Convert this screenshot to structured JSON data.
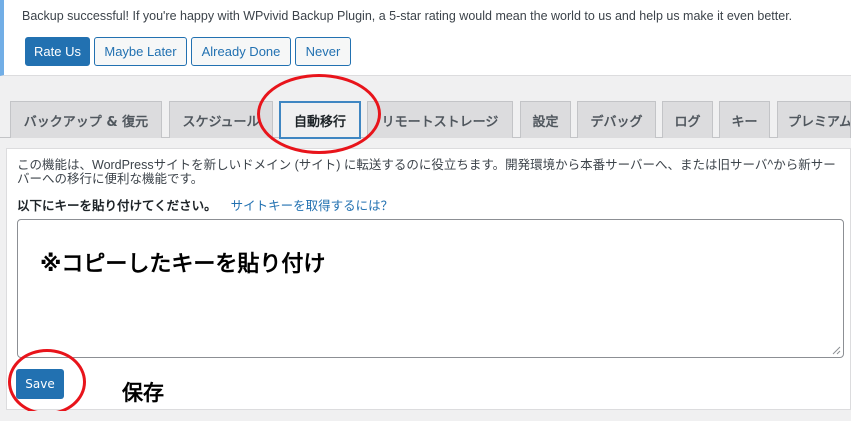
{
  "notice": {
    "text": "Backup successful! If you're happy with WPvivid Backup Plugin, a 5-star rating would mean the world to us and help us make it even better.",
    "buttons": [
      "Rate Us",
      "Maybe Later",
      "Already Done",
      "Never"
    ]
  },
  "tabs": [
    {
      "label": "バックアップ & 復元"
    },
    {
      "label": "スケジュール"
    },
    {
      "label": "自動移行",
      "active": true
    },
    {
      "label": "リモートストレージ"
    },
    {
      "label": "設定"
    },
    {
      "label": "デバッグ"
    },
    {
      "label": "ログ"
    },
    {
      "label": "キー"
    },
    {
      "label": "プレミアム"
    }
  ],
  "migration": {
    "description": "この機能は、WordPressサイトを新しいドメイン (サイト) に転送するのに役立ちます。開発環境から本番サーバーへ、または旧サーバ^から新サーバーへの移行に便利な機能です。",
    "key_label": "以下にキーを貼り付けてください。",
    "key_link": "サイトキーを取得するには？",
    "save_label": "Save"
  },
  "annotations": {
    "paste_key": "※コピーしたキーを貼り付け",
    "save": "保存",
    "highlight_color": "#e8141b"
  },
  "colors": {
    "accent": "#2271b1",
    "notice_border": "#72aee6"
  }
}
